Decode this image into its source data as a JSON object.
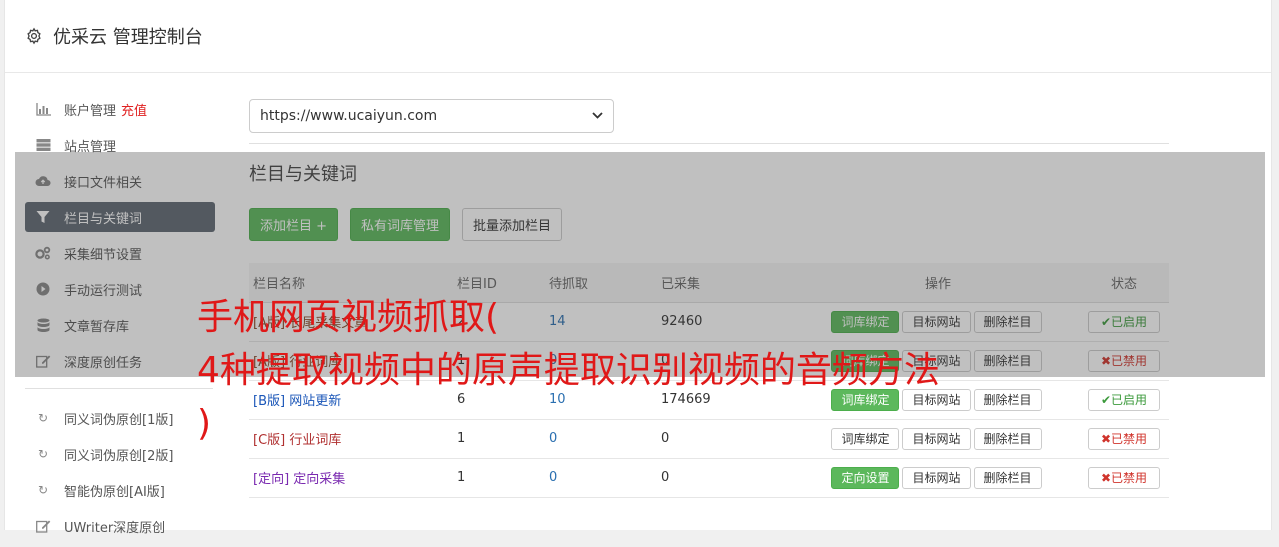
{
  "header": {
    "title": "优采云 管理控制台",
    "icon": "gear-icon"
  },
  "sidebar": {
    "items": [
      {
        "label": "账户管理",
        "extra": "充值",
        "icon": "bar-chart-icon"
      },
      {
        "label": "站点管理",
        "icon": "server-icon"
      },
      {
        "label": "接口文件相关",
        "icon": "cloud-upload-icon"
      },
      {
        "label": "栏目与关键词",
        "icon": "filter-icon",
        "active": true
      },
      {
        "label": "采集细节设置",
        "icon": "cogs-icon"
      },
      {
        "label": "手动运行测试",
        "icon": "play-circle-icon"
      },
      {
        "label": "文章暂存库",
        "icon": "database-icon"
      },
      {
        "label": "深度原创任务",
        "icon": "edit-icon"
      }
    ],
    "items2": [
      {
        "label": "同义词伪原创[1版]",
        "icon": "refresh-icon"
      },
      {
        "label": "同义词伪原创[2版]",
        "icon": "refresh-icon"
      },
      {
        "label": "智能伪原创[AI版]",
        "icon": "refresh-icon"
      },
      {
        "label": "UWriter深度原创",
        "icon": "edit-icon"
      }
    ]
  },
  "main": {
    "site_select": "https://www.ucaiyun.com",
    "section_title": "栏目与关键词",
    "buttons": {
      "add": "添加栏目 +",
      "private": "私有词库管理",
      "batch": "批量添加栏目"
    },
    "table": {
      "headers": [
        "栏目名称",
        "栏目ID",
        "待抓取",
        "已采集",
        "操作",
        "状态"
      ],
      "rows": [
        {
          "tag": "[A版]",
          "name": "长尾采集文章",
          "id": "2",
          "wait": "14",
          "done": "92460",
          "op1": "词库绑定",
          "op2": "目标网站",
          "op3": "删除栏目",
          "status": "✔已启用"
        },
        {
          "tag": "[A版]",
          "name": "行业词库",
          "id": "1",
          "wait": "0",
          "done": "0",
          "op1": "词库绑定",
          "op2": "目标网站",
          "op3": "删除栏目",
          "status": "✖已禁用"
        },
        {
          "tag": "[B版]",
          "name": "网站更新",
          "id": "6",
          "wait": "10",
          "done": "174669",
          "op1": "词库绑定",
          "op2": "目标网站",
          "op3": "删除栏目",
          "status": "✔已启用"
        },
        {
          "tag": "[C版]",
          "name": "行业词库",
          "id": "1",
          "wait": "0",
          "done": "0",
          "op1": "词库绑定",
          "op2": "目标网站",
          "op3": "删除栏目",
          "status": "✖已禁用"
        },
        {
          "tag": "[定向]",
          "name": "定向采集",
          "id": "1",
          "wait": "0",
          "done": "0",
          "op1": "定向设置",
          "op2": "目标网站",
          "op3": "删除栏目",
          "status": "✖已禁用"
        }
      ]
    }
  },
  "overlay_title": {
    "line1": "手机网页视频抓取(",
    "line2": "4种提取视频中的原声提取识别视频的音频方法",
    "line3": ")"
  },
  "colors": {
    "active_bg": "#5f6872",
    "green": "#5cb85c",
    "overlay_text": "#e01818"
  }
}
